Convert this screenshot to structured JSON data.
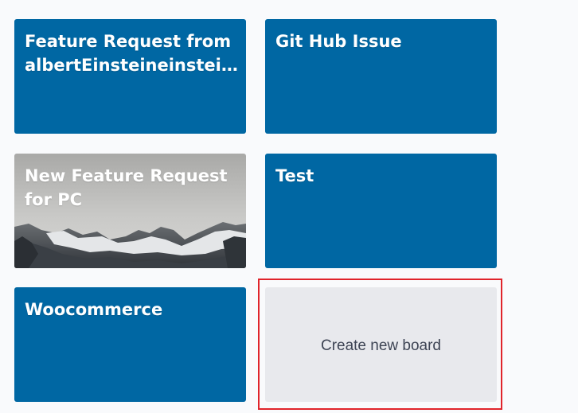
{
  "boards": [
    {
      "title": "Feature Request from albertEinsteineinsteinstein...",
      "style": "blue"
    },
    {
      "title": "Git Hub Issue",
      "style": "blue"
    },
    {
      "title": "New Feature Request for PC",
      "style": "photo"
    },
    {
      "title": "Test",
      "style": "blue"
    },
    {
      "title": "Woocommerce",
      "style": "blue"
    }
  ],
  "create_board": {
    "label": "Create new board"
  },
  "colors": {
    "tile_blue": "#0067a3",
    "create_bg": "#e8e9ed",
    "highlight_border": "#e0242b",
    "page_bg": "#f9fafc"
  }
}
